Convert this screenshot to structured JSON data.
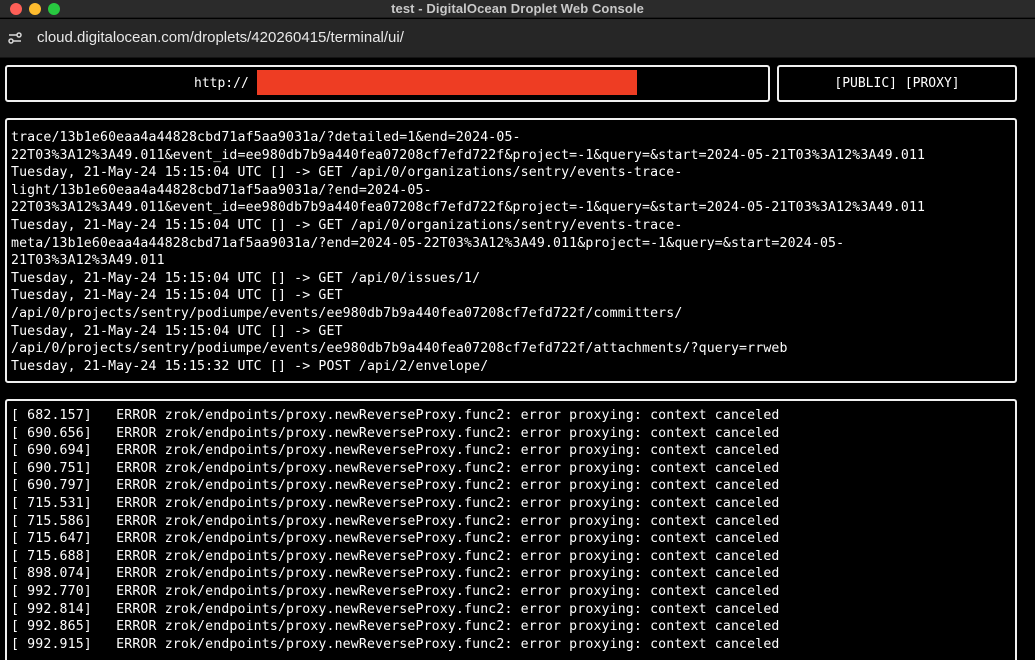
{
  "window": {
    "title": "test - DigitalOcean Droplet Web Console"
  },
  "browser": {
    "url": "cloud.digitalocean.com/droplets/420260415/terminal/ui/",
    "site_settings_icon": "site-settings-icon"
  },
  "terminal": {
    "url_prefix": "http://",
    "tags": "[PUBLIC] [PROXY]",
    "colors": {
      "background": "#000000",
      "text": "#ffffff",
      "border": "#f0f0f0",
      "redaction": "#ee3d23"
    },
    "request_log": [
      "trace/13b1e60eaa4a44828cbd71af5aa9031a/?detailed=1&end=2024-05-",
      "22T03%3A12%3A49.011&event_id=ee980db7b9a440fea07208cf7efd722f&project=-1&query=&start=2024-05-21T03%3A12%3A49.011",
      "Tuesday, 21-May-24 15:15:04 UTC [] -> GET /api/0/organizations/sentry/events-trace-",
      "light/13b1e60eaa4a44828cbd71af5aa9031a/?end=2024-05-",
      "22T03%3A12%3A49.011&event_id=ee980db7b9a440fea07208cf7efd722f&project=-1&query=&start=2024-05-21T03%3A12%3A49.011",
      "Tuesday, 21-May-24 15:15:04 UTC [] -> GET /api/0/organizations/sentry/events-trace-",
      "meta/13b1e60eaa4a44828cbd71af5aa9031a/?end=2024-05-22T03%3A12%3A49.011&project=-1&query=&start=2024-05-",
      "21T03%3A12%3A49.011",
      "Tuesday, 21-May-24 15:15:04 UTC [] -> GET /api/0/issues/1/",
      "Tuesday, 21-May-24 15:15:04 UTC [] -> GET",
      "/api/0/projects/sentry/podiumpe/events/ee980db7b9a440fea07208cf7efd722f/committers/",
      "Tuesday, 21-May-24 15:15:04 UTC [] -> GET",
      "/api/0/projects/sentry/podiumpe/events/ee980db7b9a440fea07208cf7efd722f/attachments/?query=rrweb",
      "Tuesday, 21-May-24 15:15:32 UTC [] -> POST /api/2/envelope/"
    ],
    "error_log": [
      "[ 682.157]   ERROR zrok/endpoints/proxy.newReverseProxy.func2: error proxying: context canceled",
      "[ 690.656]   ERROR zrok/endpoints/proxy.newReverseProxy.func2: error proxying: context canceled",
      "[ 690.694]   ERROR zrok/endpoints/proxy.newReverseProxy.func2: error proxying: context canceled",
      "[ 690.751]   ERROR zrok/endpoints/proxy.newReverseProxy.func2: error proxying: context canceled",
      "[ 690.797]   ERROR zrok/endpoints/proxy.newReverseProxy.func2: error proxying: context canceled",
      "[ 715.531]   ERROR zrok/endpoints/proxy.newReverseProxy.func2: error proxying: context canceled",
      "[ 715.586]   ERROR zrok/endpoints/proxy.newReverseProxy.func2: error proxying: context canceled",
      "[ 715.647]   ERROR zrok/endpoints/proxy.newReverseProxy.func2: error proxying: context canceled",
      "[ 715.688]   ERROR zrok/endpoints/proxy.newReverseProxy.func2: error proxying: context canceled",
      "[ 898.074]   ERROR zrok/endpoints/proxy.newReverseProxy.func2: error proxying: context canceled",
      "[ 992.770]   ERROR zrok/endpoints/proxy.newReverseProxy.func2: error proxying: context canceled",
      "[ 992.814]   ERROR zrok/endpoints/proxy.newReverseProxy.func2: error proxying: context canceled",
      "[ 992.865]   ERROR zrok/endpoints/proxy.newReverseProxy.func2: error proxying: context canceled",
      "[ 992.915]   ERROR zrok/endpoints/proxy.newReverseProxy.func2: error proxying: context canceled"
    ]
  }
}
